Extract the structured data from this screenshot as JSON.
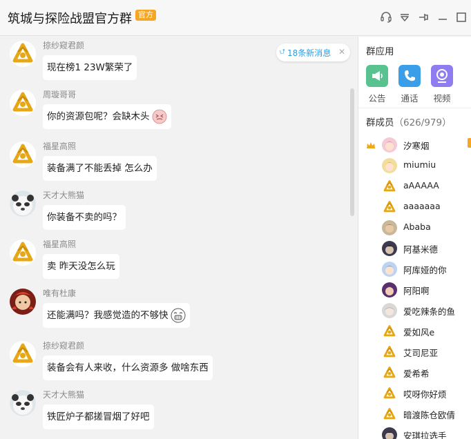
{
  "header": {
    "title": "筑城与探险战盟官方群",
    "badge": "官方"
  },
  "chat": {
    "new_messages": "18条新消息",
    "messages": [
      {
        "sender": "掠纱窥君颜",
        "text": "现在榜1  23W繁荣了",
        "avatar": "gold-logo-avatar",
        "emoji": null
      },
      {
        "sender": "周璇哥哥",
        "text": "你的资源包呢？会缺木头",
        "avatar": "gold-logo-avatar",
        "emoji": "awkward-face-emoji"
      },
      {
        "sender": "福星高照",
        "text": "装备满了不能丢掉 怎么办",
        "avatar": "gold-logo-avatar",
        "emoji": null
      },
      {
        "sender": "天才大熊猫",
        "text": "你装备不卖的吗？",
        "avatar": "panda-avatar",
        "emoji": null
      },
      {
        "sender": "福星高照",
        "text": "卖 昨天没怎么玩",
        "avatar": "gold-logo-avatar",
        "emoji": null
      },
      {
        "sender": "唯有杜康",
        "text": "还能满吗？我感觉造的不够快",
        "avatar": "red-hero-avatar",
        "emoji": "crying-face-emoji"
      },
      {
        "sender": "掠纱窥君颜",
        "text": "装备会有人来收，什么资源多  做啥东西",
        "avatar": "gold-logo-avatar",
        "emoji": null
      },
      {
        "sender": "天才大熊猫",
        "text": "铁匠炉子都搓冒烟了好吧",
        "avatar": "panda-avatar",
        "emoji": null
      }
    ]
  },
  "panel": {
    "apps_title": "群应用",
    "apps": [
      {
        "label": "公告",
        "color": "#5ac28e",
        "icon": "megaphone-icon"
      },
      {
        "label": "通话",
        "color": "#3a9fe8",
        "icon": "phone-icon"
      },
      {
        "label": "视频",
        "color": "#8e7cf0",
        "icon": "camera-icon"
      }
    ],
    "members_title": "群成员",
    "members_count": "（626/979）",
    "members": [
      {
        "name": "汐寒烟",
        "avatar": "pink-girl-avatar",
        "owner": true
      },
      {
        "name": "miumiu",
        "avatar": "blonde-girl-avatar",
        "owner": false
      },
      {
        "name": "aAAAAA",
        "avatar": "gold-logo-avatar",
        "owner": false
      },
      {
        "name": "aaaaaaa",
        "avatar": "gold-logo-avatar",
        "owner": false
      },
      {
        "name": "Ababa",
        "avatar": "warrior-avatar",
        "owner": false
      },
      {
        "name": "阿基米德",
        "avatar": "dark-hero-avatar",
        "owner": false
      },
      {
        "name": "阿库娅的你",
        "avatar": "blue-girl-avatar",
        "owner": false
      },
      {
        "name": "阿阳啊",
        "avatar": "purple-hero-avatar",
        "owner": false
      },
      {
        "name": "爱吃辣条的鱼",
        "avatar": "pale-avatar",
        "owner": false
      },
      {
        "name": "爱如风e",
        "avatar": "gold-logo-avatar",
        "owner": false
      },
      {
        "name": "艾司尼亚",
        "avatar": "gold-logo-avatar",
        "owner": false
      },
      {
        "name": "爱希希",
        "avatar": "gold-logo-avatar",
        "owner": false
      },
      {
        "name": "哎呀你好烦",
        "avatar": "gold-logo-avatar",
        "owner": false
      },
      {
        "name": "暗渡陈仓欧倩",
        "avatar": "gold-logo-avatar",
        "owner": false
      },
      {
        "name": "安琪拉选手",
        "avatar": "dark-hero-avatar",
        "owner": false
      }
    ]
  },
  "colors": {
    "accent_blue": "#27a0e6",
    "badge_orange": "#f5a623",
    "logo_gold": "#e6a817"
  }
}
